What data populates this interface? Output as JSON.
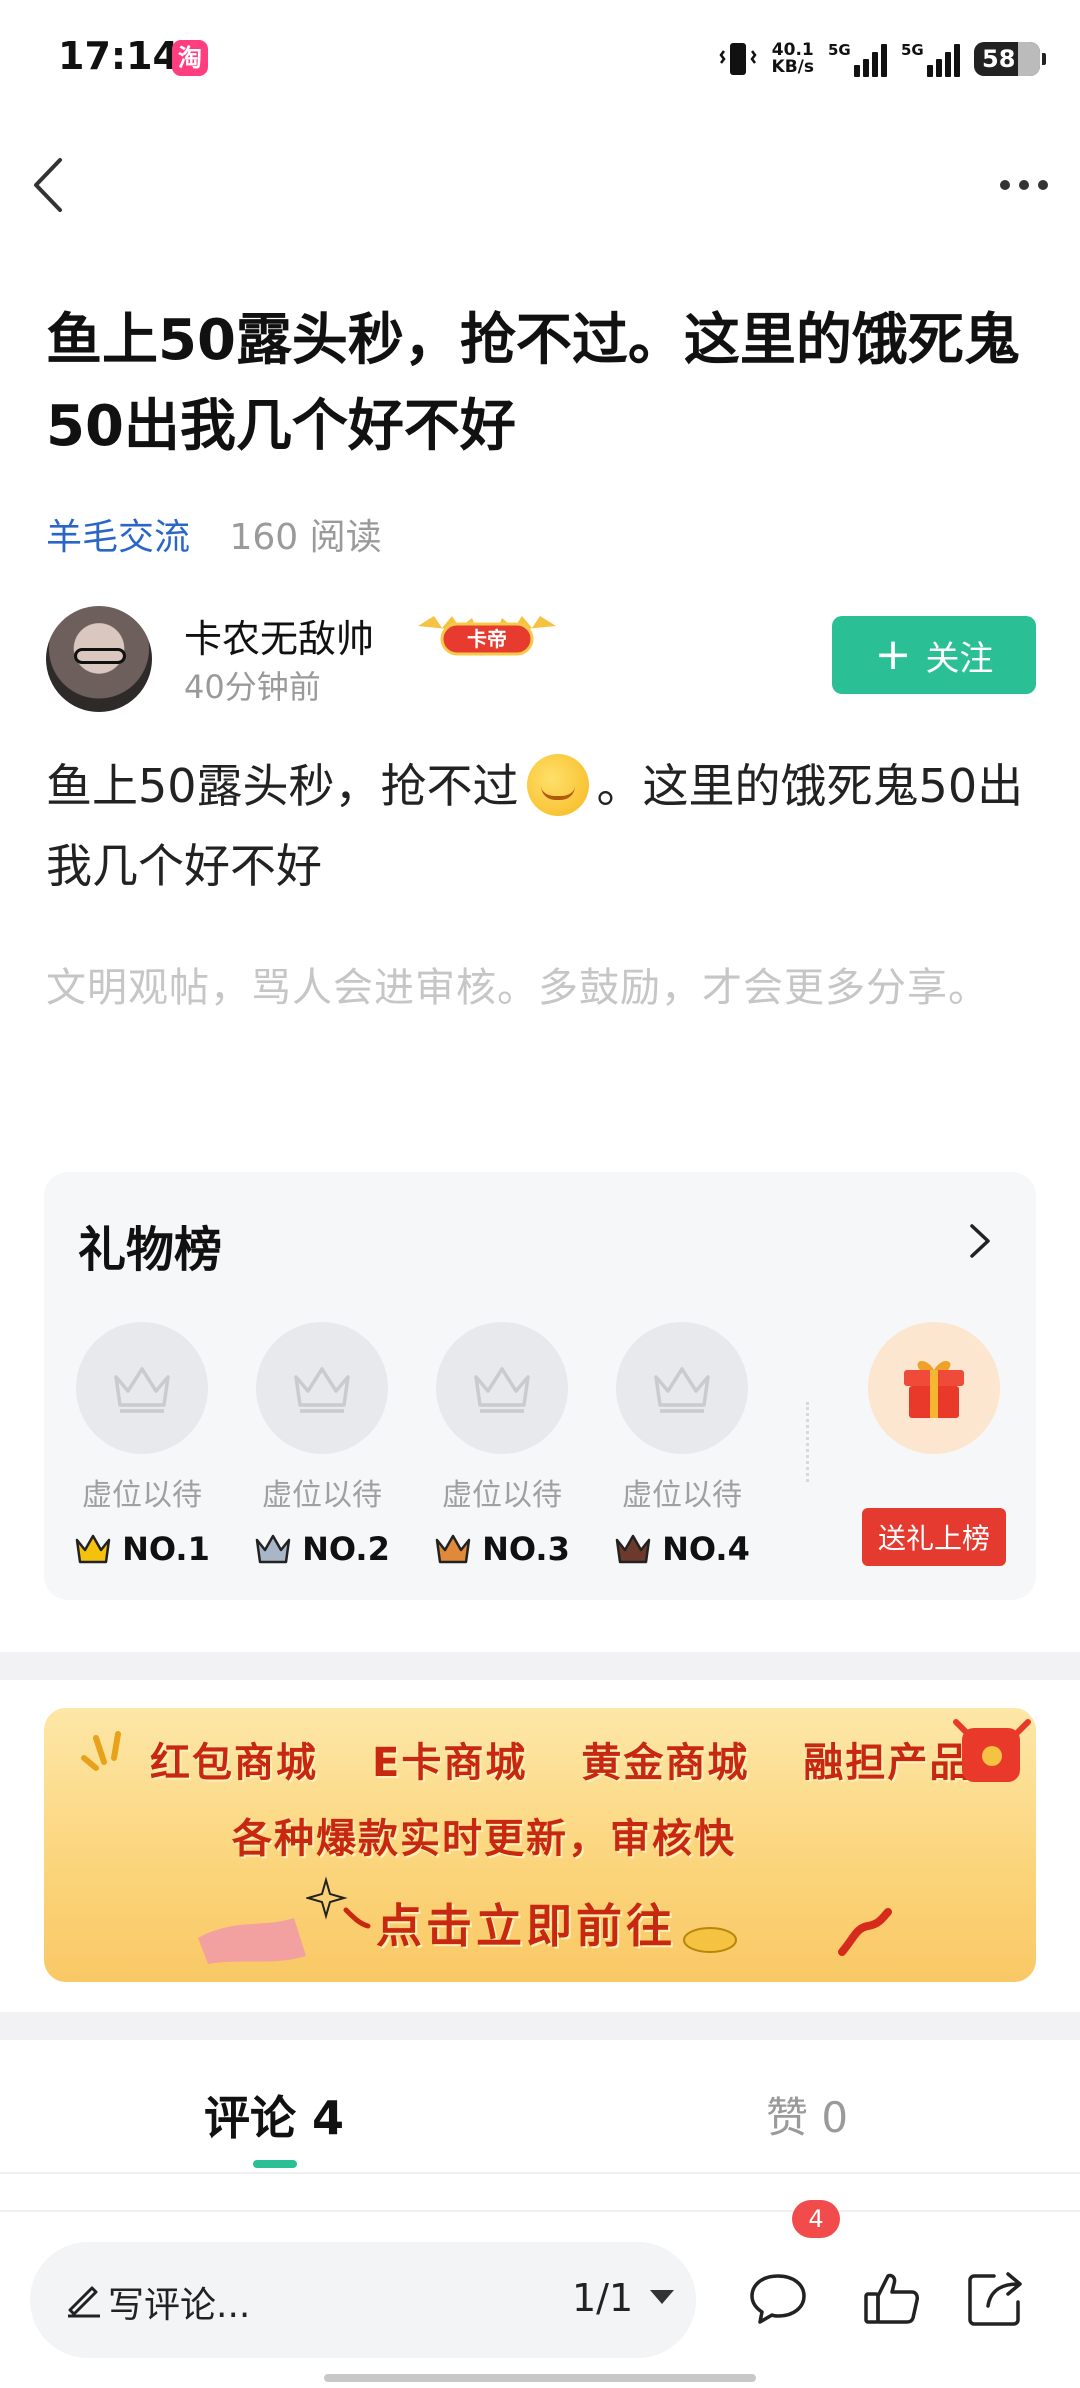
{
  "status_bar": {
    "time": "17:14",
    "app_icon_char": "淘",
    "net_speed_value": "40.1",
    "net_speed_unit": "KB/s",
    "signal1_label": "5G",
    "signal2_label": "5G",
    "battery": "58"
  },
  "post": {
    "title": "鱼上50露头秒，抢不过。这里的饿死鬼50出我几个好不好",
    "category": "羊毛交流",
    "reads": "160 阅读",
    "author_name": "卡农无敌帅",
    "author_badge": "卡帝",
    "author_time": "40分钟前",
    "follow_label": "关注",
    "body_part1": "鱼上50露头秒，抢不过",
    "body_part2": "。这里的饿死鬼50出我几个好不好",
    "notice": "文明观帖，骂人会进审核。多鼓励，才会更多分享。"
  },
  "gift_board": {
    "title": "礼物榜",
    "slots": [
      {
        "placeholder": "虚位以待",
        "rank": "NO.1"
      },
      {
        "placeholder": "虚位以待",
        "rank": "NO.2"
      },
      {
        "placeholder": "虚位以待",
        "rank": "NO.3"
      },
      {
        "placeholder": "虚位以待",
        "rank": "NO.4"
      }
    ],
    "send_gift_label": "送礼上榜",
    "rank_colors": [
      "#f4c20d",
      "#a9b6c8",
      "#e0893a",
      "#6b3a2a"
    ]
  },
  "banner": {
    "items": [
      "红包商城",
      "E卡商城",
      "黄金商城",
      "融担产品"
    ],
    "subtitle": "各种爆款实时更新，审核快",
    "cta": "点击立即前往"
  },
  "tabs": {
    "comments": "评论 4",
    "likes": "赞 0"
  },
  "bottom_bar": {
    "comment_placeholder": "写评论...",
    "page_indicator": "1/1",
    "comment_count": "4"
  },
  "colors": {
    "accent": "#2bbf96",
    "link": "#2a66c8",
    "badge_red": "#e53a2f"
  }
}
